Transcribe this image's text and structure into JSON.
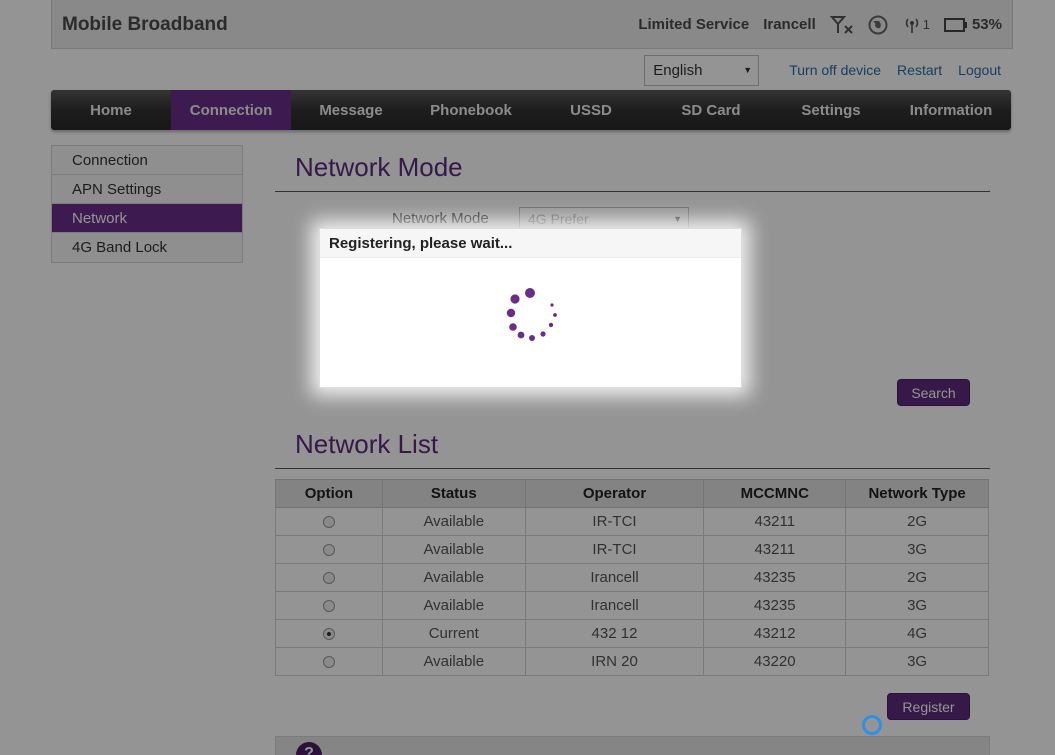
{
  "header": {
    "brand": "Mobile Broadband",
    "service_status": "Limited Service",
    "operator": "Irancell",
    "signal_icon": "no-signal-icon",
    "globe_icon": "globe-icon",
    "wifi_clients": "1",
    "battery_percent": "53%"
  },
  "toprow": {
    "language": "English",
    "turn_off": "Turn off device",
    "restart": "Restart",
    "logout": "Logout"
  },
  "nav": {
    "items": [
      {
        "label": "Home"
      },
      {
        "label": "Connection"
      },
      {
        "label": "Message"
      },
      {
        "label": "Phonebook"
      },
      {
        "label": "USSD"
      },
      {
        "label": "SD Card"
      },
      {
        "label": "Settings"
      },
      {
        "label": "Information"
      }
    ],
    "active": "Connection"
  },
  "sidebar": {
    "items": [
      {
        "label": "Connection"
      },
      {
        "label": "APN Settings"
      },
      {
        "label": "Network"
      },
      {
        "label": "4G Band Lock"
      }
    ],
    "active": "Network"
  },
  "network_mode": {
    "title": "Network Mode",
    "label": "Network Mode",
    "value": "4G Prefer",
    "search_button": "Search"
  },
  "network_list": {
    "title": "Network List",
    "columns": [
      "Option",
      "Status",
      "Operator",
      "MCCMNC",
      "Network Type"
    ],
    "rows": [
      {
        "status": "Available",
        "operator": "IR-TCI",
        "mccmnc": "43211",
        "type": "2G",
        "selected": false
      },
      {
        "status": "Available",
        "operator": "IR-TCI",
        "mccmnc": "43211",
        "type": "3G",
        "selected": false
      },
      {
        "status": "Available",
        "operator": "Irancell",
        "mccmnc": "43235",
        "type": "2G",
        "selected": false
      },
      {
        "status": "Available",
        "operator": "Irancell",
        "mccmnc": "43235",
        "type": "3G",
        "selected": false
      },
      {
        "status": "Current",
        "operator": "432 12",
        "mccmnc": "43212",
        "type": "4G",
        "selected": true
      },
      {
        "status": "Available",
        "operator": "IRN 20",
        "mccmnc": "43220",
        "type": "3G",
        "selected": false
      }
    ],
    "register_button": "Register"
  },
  "modal": {
    "title": "Registering, please wait..."
  },
  "footer": {
    "help_icon": "?"
  },
  "colors": {
    "accent": "#5e2a7e",
    "nav_active": "#6a2d8a",
    "link": "#2a6ca8"
  }
}
